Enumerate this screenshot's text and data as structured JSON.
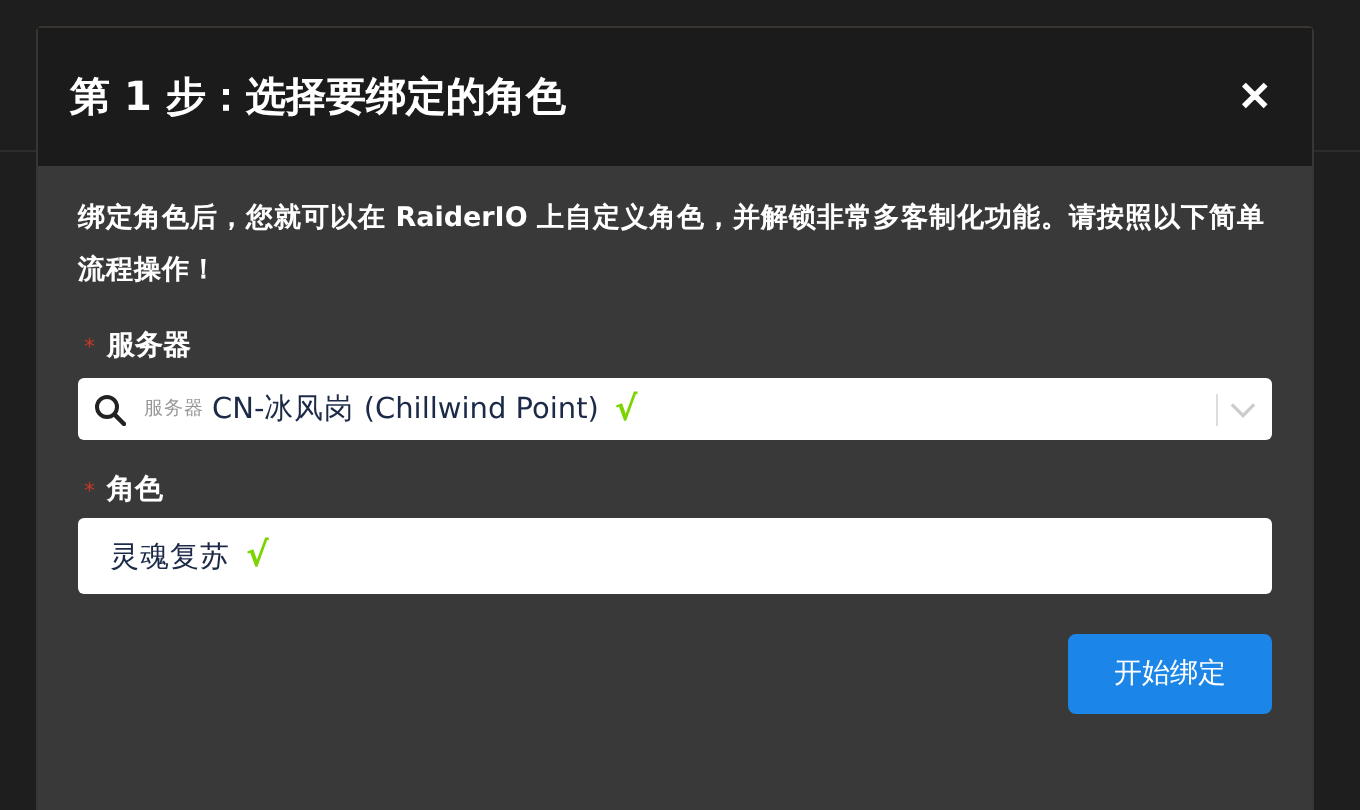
{
  "dialog": {
    "title": "第 1 步：选择要绑定的角色",
    "close": "✕",
    "description": "绑定角色后，您就可以在 RaiderIO 上自定义角色，并解锁非常多客制化功能。请按照以下简单流程操作！",
    "fields": [
      {
        "kind": "select",
        "required_mark": "*",
        "label": "服务器",
        "prefix": "服务器",
        "value": "CN-冰风岗 (Chillwind Point)",
        "check": "√"
      },
      {
        "kind": "text",
        "required_mark": "*",
        "label": "角色",
        "value": "灵魂复苏",
        "check": "√"
      }
    ],
    "submit": "开始绑定"
  }
}
